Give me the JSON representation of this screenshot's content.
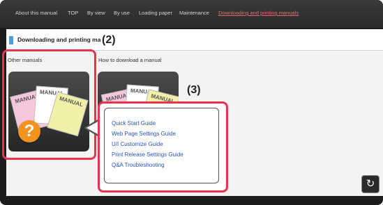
{
  "nav": {
    "items": [
      {
        "label": "About this manual",
        "active": false
      },
      {
        "label": "TOP",
        "active": false
      },
      {
        "label": "By view",
        "active": false
      },
      {
        "label": "By use",
        "active": false
      },
      {
        "label": "Loading paper",
        "active": false
      },
      {
        "label": "Maintenance",
        "active": false
      },
      {
        "label": "Downloading and printing manuals",
        "active": true
      }
    ]
  },
  "page": {
    "title": "Downloading and printing ma",
    "title_marker_color": "#4a9ee0"
  },
  "sections": {
    "other_manuals": "Other manuals",
    "how_to_download": "How to download a manual"
  },
  "tile": {
    "sheet_text": "MANUAL",
    "help_glyph": "?",
    "help_color": "#f0931f"
  },
  "callouts": {
    "left": "(2)",
    "popup": "(3)",
    "highlight_color": "#e8334d"
  },
  "popup": {
    "links": [
      "Quick Start Guide",
      "Web Page Settings Guide",
      "U/I Customize Guide",
      "Print Release Settings Guide",
      "Q&A Troubleshooting"
    ]
  },
  "controls": {
    "reset_icon": "refresh-icon",
    "reset_glyph": "↻"
  }
}
